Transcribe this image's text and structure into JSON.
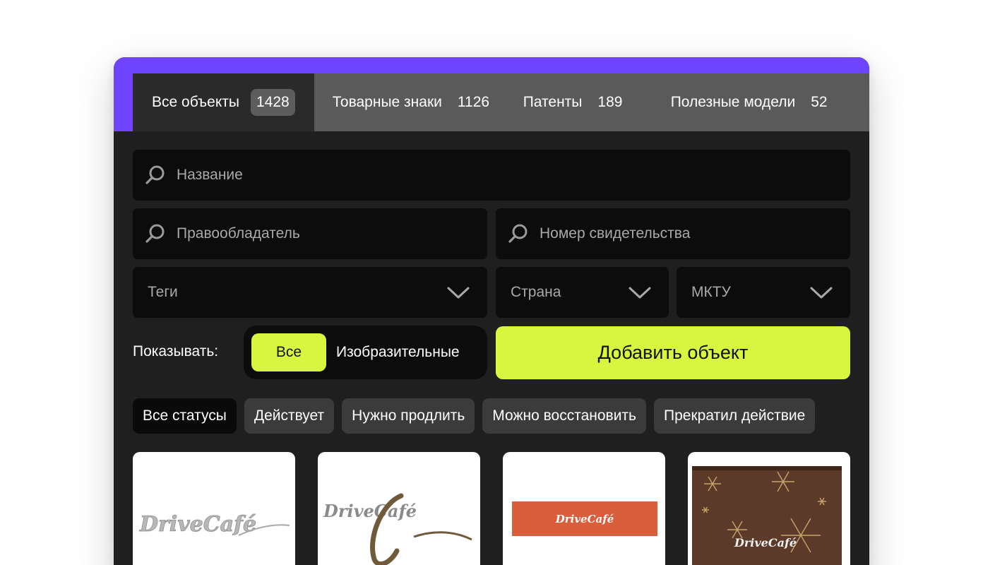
{
  "tabs": [
    {
      "label": "Все объекты",
      "count": "1428"
    },
    {
      "label": "Товарные знаки",
      "count": "1126"
    },
    {
      "label": "Патенты",
      "count": "189"
    },
    {
      "label": "Полезные модели",
      "count": "52"
    }
  ],
  "search": {
    "name_placeholder": "Название",
    "holder_placeholder": "Правообладатель",
    "cert_placeholder": "Номер свидетельства"
  },
  "filters": {
    "tags": "Теги",
    "country": "Страна",
    "mktu": "МКТУ"
  },
  "display": {
    "label": "Показывать:",
    "option_all": "Все",
    "option_figurative": "Изобразительные"
  },
  "add_button": "Добавить объект",
  "statuses": [
    "Все статусы",
    "Действует",
    "Нужно продлить",
    "Можно восстановить",
    "Прекратил действие"
  ],
  "cards": [
    {
      "logo_text": "DriveCafé",
      "style": "silver"
    },
    {
      "logo_text": "DriveCafé",
      "style": "bronze"
    },
    {
      "logo_text": "DriveCafé",
      "style": "orange-banner"
    },
    {
      "logo_text": "DriveCafé",
      "style": "brown-snowflake"
    }
  ],
  "colors": {
    "accent": "#6e44ff",
    "lime": "#d8f53f",
    "panel": "#1f1f1f",
    "field": "#0c0c0c"
  }
}
